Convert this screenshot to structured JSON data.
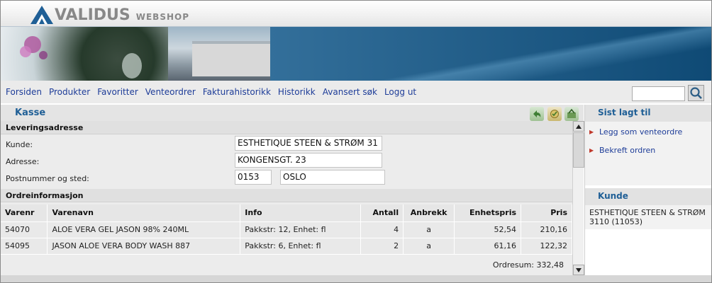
{
  "header": {
    "brand": "VALIDUS",
    "subtitle": "WEBSHOP"
  },
  "nav": {
    "links": [
      "Forsiden",
      "Produkter",
      "Favoritter",
      "Venteordrer",
      "Fakturahistorikk",
      "Historikk",
      "Avansert søk",
      "Logg ut"
    ],
    "search_value": ""
  },
  "main": {
    "title": "Kasse",
    "delivery": {
      "heading": "Leveringsadresse",
      "customer_label": "Kunde:",
      "customer_value": "ESTHETIQUE STEEN & STRØM 31",
      "address_label": "Adresse:",
      "address_value": "KONGENSGT. 23",
      "postal_label": "Postnummer og sted:",
      "postal_code": "0153",
      "city": "OSLO"
    },
    "order": {
      "heading": "Ordreinformasjon",
      "columns": [
        "Varenr",
        "Varenavn",
        "Info",
        "Antall",
        "Anbrekk",
        "Enhetspris",
        "Pris"
      ],
      "rows": [
        [
          "54070",
          "ALOE VERA GEL JASON 98% 240ML",
          "Pakkstr: 12, Enhet: fl",
          "4",
          "a",
          "52,54",
          "210,16"
        ],
        [
          "54095",
          "JASON ALOE VERA BODY WASH 887",
          "Pakkstr: 6, Enhet: fl",
          "2",
          "a",
          "61,16",
          "122,32"
        ]
      ],
      "sum": "Ordresum: 332,48"
    }
  },
  "side": {
    "recent_title": "Sist lagt til",
    "links": [
      "Legg som venteordre",
      "Bekreft ordren"
    ],
    "customer_title": "Kunde",
    "customer_text": "ESTHETIQUE STEEN & STRØM 3110 (11053)"
  },
  "colors": {
    "accent": "#1f5f96",
    "link": "#1d3c98",
    "banner": "#0f4a75"
  },
  "icons": [
    "back-arrow-icon",
    "cart-icon",
    "save-order-icon",
    "search-icon",
    "scroll-up-icon",
    "scroll-down-icon"
  ]
}
